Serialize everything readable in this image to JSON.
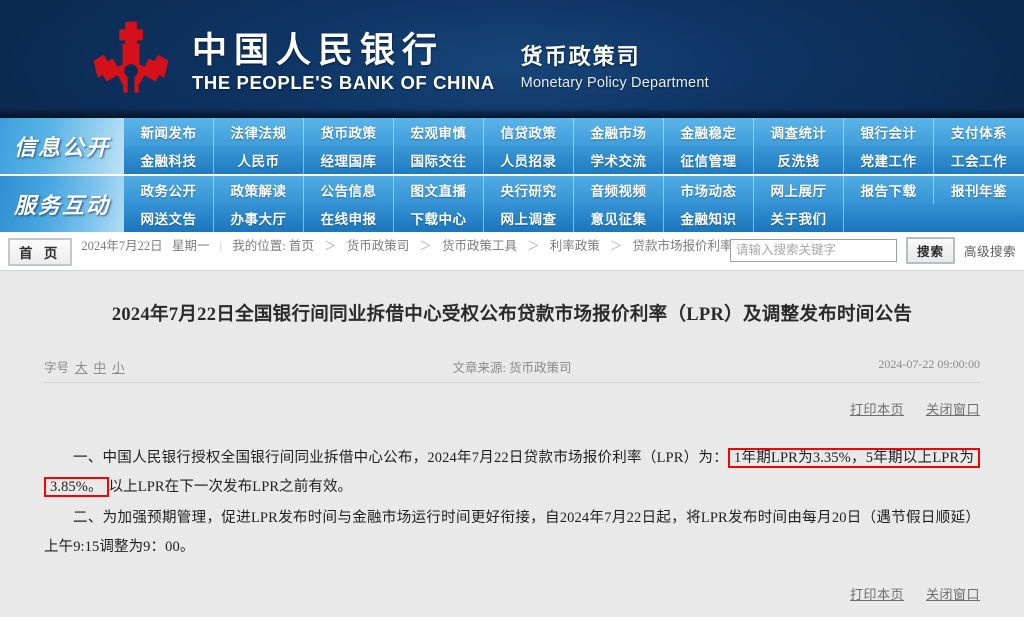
{
  "header": {
    "logo_icon": "pboc-emblem-icon",
    "bank_name_cn": "中国人民银行",
    "bank_name_en": "THE PEOPLE'S BANK OF CHINA",
    "department_cn": "货币政策司",
    "department_en": "Monetary Policy Department"
  },
  "nav": {
    "groups": [
      {
        "side_label": "信息公开",
        "rows": [
          [
            "新闻发布",
            "法律法规",
            "货币政策",
            "宏观审慎",
            "信贷政策",
            "金融市场",
            "金融稳定",
            "调查统计",
            "银行会计",
            "支付体系"
          ],
          [
            "金融科技",
            "人民币",
            "经理国库",
            "国际交往",
            "人员招录",
            "学术交流",
            "征信管理",
            "反洗钱",
            "党建工作",
            "工会工作"
          ]
        ]
      },
      {
        "side_label": "服务互动",
        "rows": [
          [
            "政务公开",
            "政策解读",
            "公告信息",
            "图文直播",
            "央行研究",
            "音频视频",
            "市场动态",
            "网上展厅",
            "报告下载",
            "报刊年鉴"
          ],
          [
            "网送文告",
            "办事大厅",
            "在线申报",
            "下载中心",
            "网上调查",
            "意见征集",
            "金融知识",
            "关于我们",
            "",
            ""
          ]
        ]
      }
    ]
  },
  "crumb": {
    "home_label": "首 页",
    "date": "2024年7月22日",
    "weekday": "星期一",
    "position_label": "我的位置:",
    "trail": [
      "首页",
      "货币政策司",
      "货币政策工具",
      "利率政策",
      "贷款市场报价利率LPR"
    ],
    "arrow": "＞"
  },
  "search": {
    "placeholder": "请输入搜索关键字",
    "value": "",
    "button_label": "搜索",
    "advanced_label": "高级搜索"
  },
  "article": {
    "title": "2024年7月22日全国银行间同业拆借中心受权公布贷款市场报价利率（LPR）及调整发布时间公告",
    "fontsize_label": "字号",
    "fontsize_options": [
      "大",
      "中",
      "小"
    ],
    "source": "文章来源: 货币政策司",
    "timestamp": "2024-07-22 09:00:00",
    "print_label": "打印本页",
    "close_label": "关闭窗口",
    "paragraph_1": {
      "before": "一、中国人民银行授权全国银行间同业拆借中心公布，2024年7月22日贷款市场报价利率（LPR）为：",
      "highlight_a": "1年期LPR为3.35%，5年期以上LPR为3.85%。",
      "after": "以上LPR在下一次发布LPR之前有效。"
    },
    "paragraph_2": "二、为加强预期管理，促进LPR发布时间与金融市场运行时间更好衔接，自2024年7月22日起，将LPR发布时间由每月20日（遇节假日顺延）上午9:15调整为9：00。"
  },
  "colors": {
    "header_navy": "#0c2b55",
    "logo_red": "#d4111a",
    "nav_blue": "#3f9ddb",
    "highlight_red": "#fb0000",
    "content_bg": "#e9e9e9"
  }
}
